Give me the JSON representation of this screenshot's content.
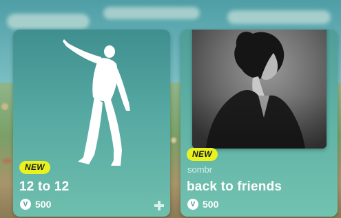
{
  "items": [
    {
      "badge": "NEW",
      "title": "12 to 12",
      "price": "500",
      "currency_icon": "vbucks-icon",
      "type_icon": "emote-silhouette-icon",
      "extra_icon": "crossplay-icon"
    },
    {
      "badge": "NEW",
      "artist": "sombr",
      "title": "back to friends",
      "price": "500",
      "currency_icon": "vbucks-icon"
    }
  ],
  "colors": {
    "badge_bg": "#e8f21f",
    "card_teal": "#56a9a2",
    "text": "#ffffff"
  }
}
